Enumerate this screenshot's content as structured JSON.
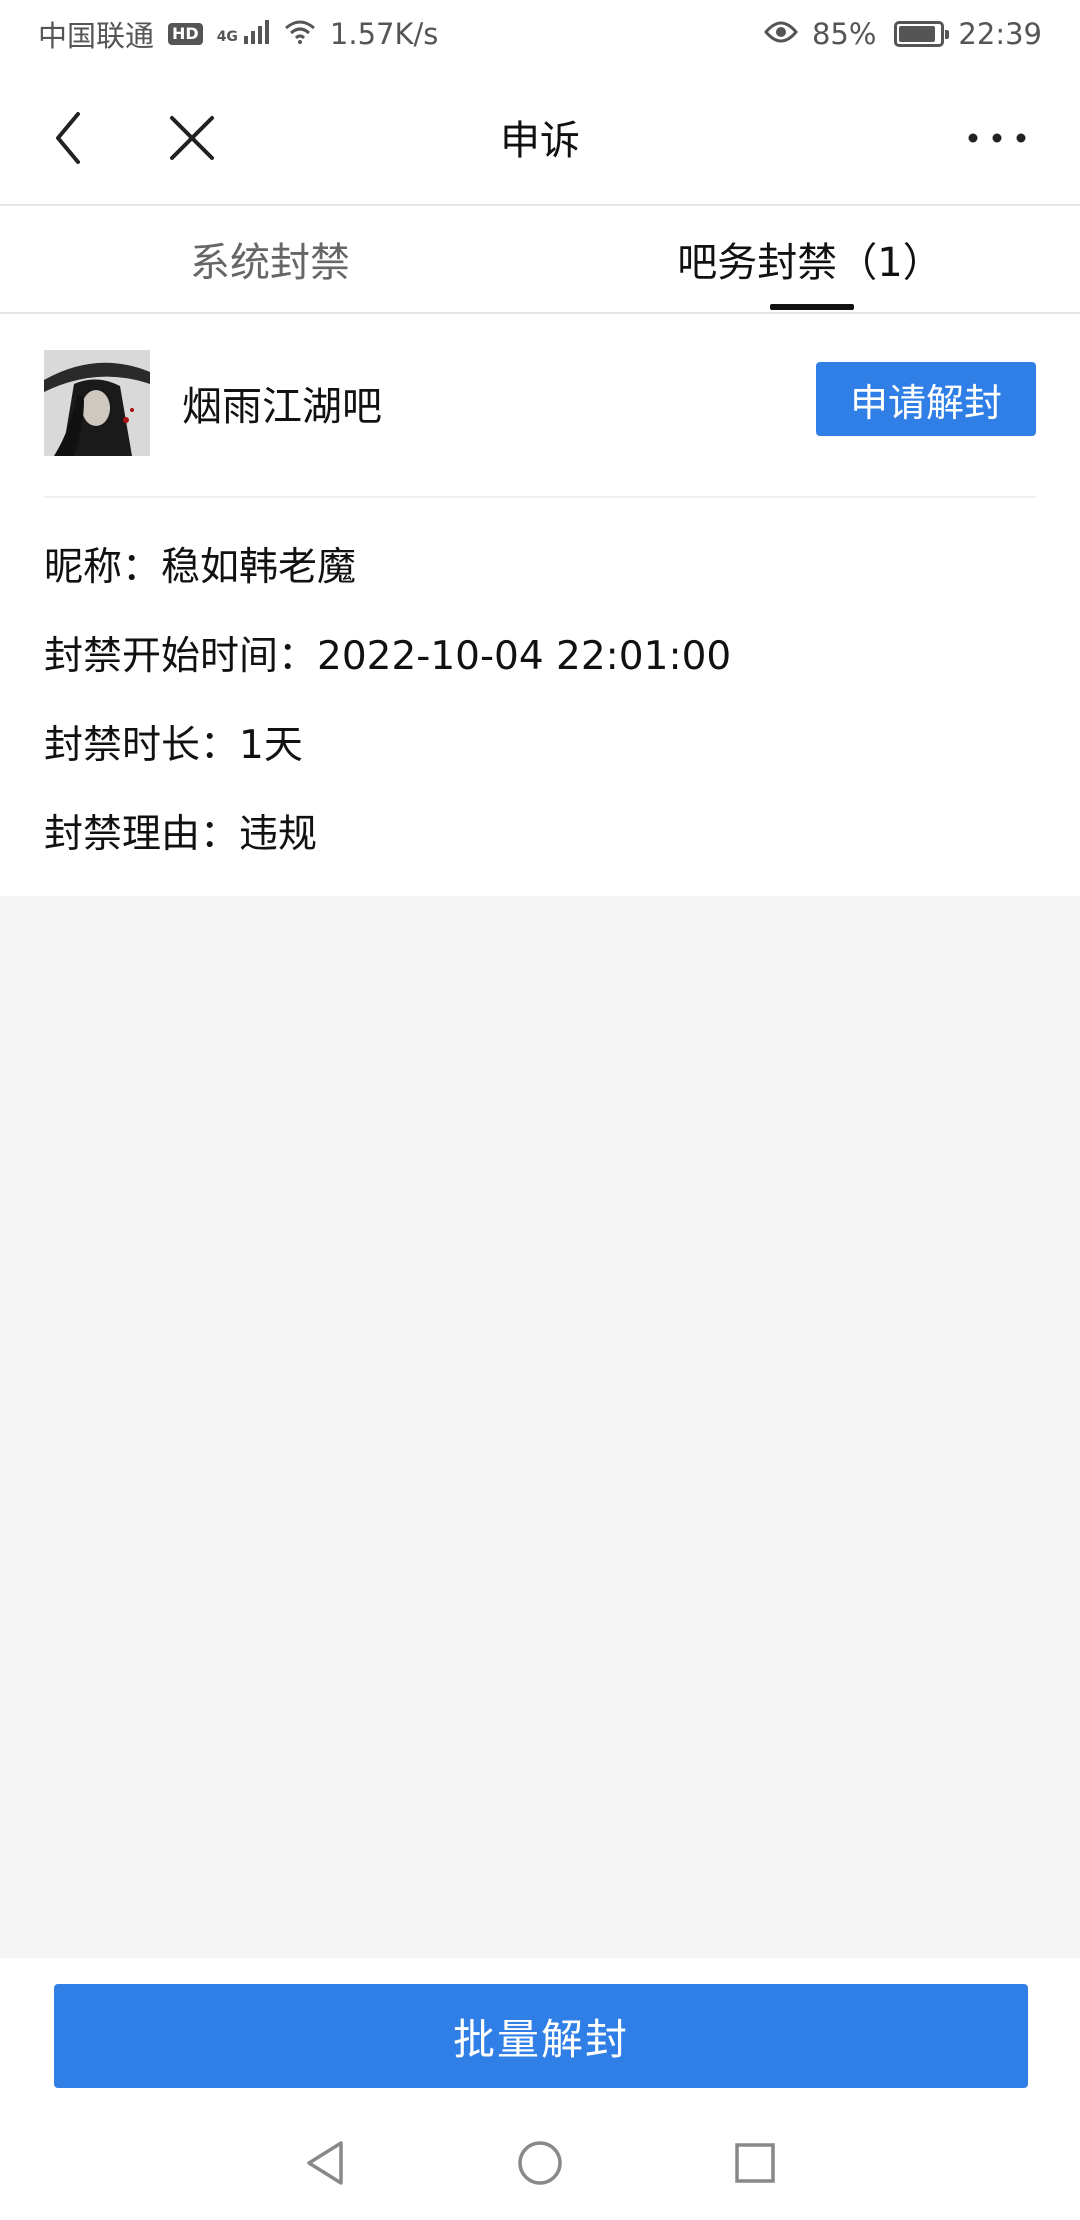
{
  "status_bar": {
    "carrier": "中国联通",
    "hd": "HD",
    "network": "4G",
    "speed": "1.57K/s",
    "battery": "85%",
    "time": "22:39"
  },
  "nav": {
    "title": "申诉"
  },
  "tabs": [
    {
      "label": "系统封禁",
      "active": false
    },
    {
      "label": "吧务封禁（1）",
      "active": true
    }
  ],
  "ban_card": {
    "forum_name": "烟雨江湖吧",
    "apply_button": "申请解封",
    "nickname": "昵称：稳如韩老魔",
    "start_time": "封禁开始时间：2022-10-04 22:01:00",
    "duration": "封禁时长：1天",
    "reason": "封禁理由：违规"
  },
  "bottom": {
    "batch_button": "批量解封"
  },
  "colors": {
    "accent": "#2f7fe6",
    "page_bg": "#f5f5f5"
  }
}
